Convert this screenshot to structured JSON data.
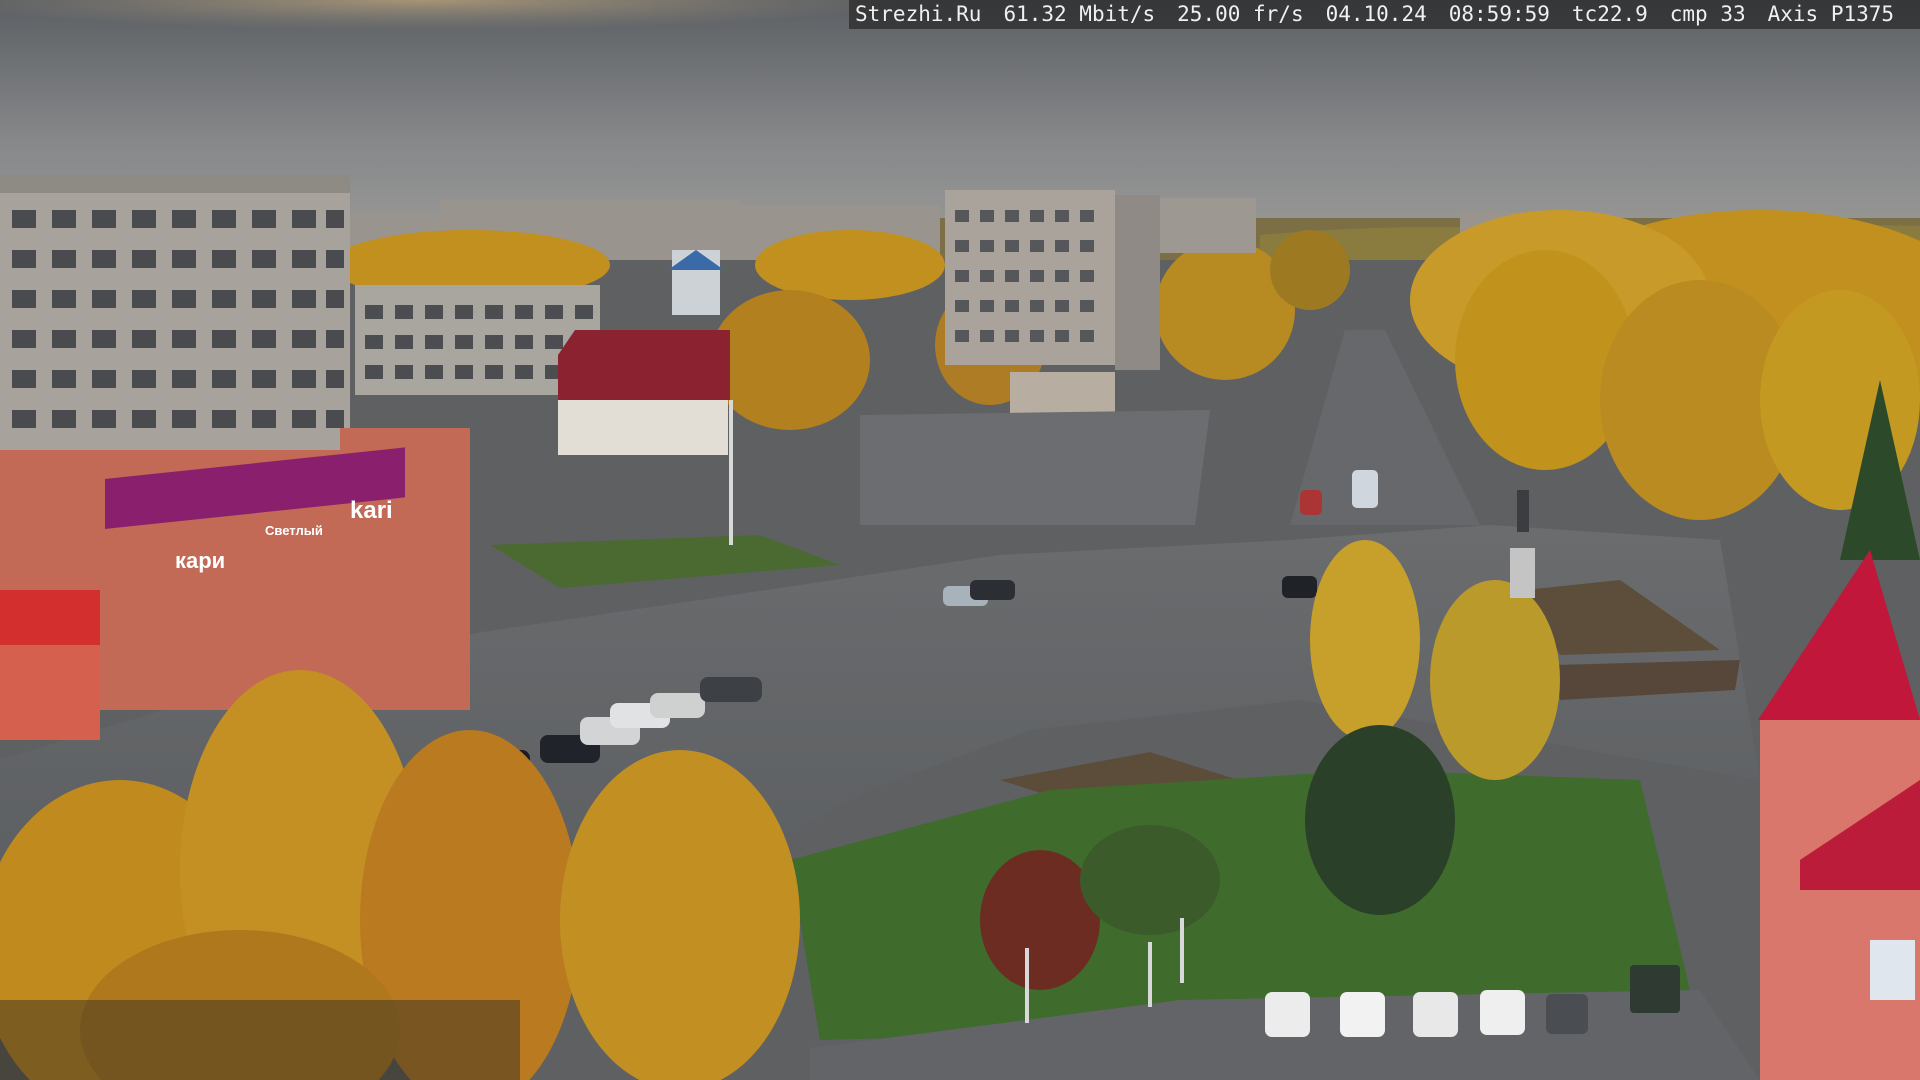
{
  "overlay": {
    "site": "Strezhi.Ru",
    "bitrate": "61.32 Mbit/s",
    "framerate": "25.00 fr/s",
    "date": "04.10.24",
    "time": "08:59:59",
    "tc": "tc22.9",
    "cmp": "cmp 33",
    "camera": "Axis P1375"
  },
  "signs": {
    "kari_logo": "kari",
    "kari_facade": "кари",
    "shop_banner": "Светлый"
  },
  "colors": {
    "sky_top": "#5f6266",
    "sky_bottom": "#8f9192",
    "foliage": "#c9931f",
    "asphalt": "#5a5d60",
    "grass": "#3f6a2c",
    "kari_purple": "#8a1f6e",
    "roof_red": "#c0173a"
  }
}
